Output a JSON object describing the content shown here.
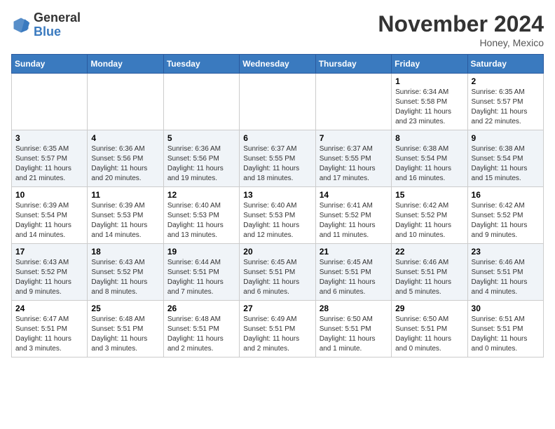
{
  "header": {
    "logo_general": "General",
    "logo_blue": "Blue",
    "month_title": "November 2024",
    "location": "Honey, Mexico"
  },
  "days_of_week": [
    "Sunday",
    "Monday",
    "Tuesday",
    "Wednesday",
    "Thursday",
    "Friday",
    "Saturday"
  ],
  "weeks": [
    [
      {
        "day": "",
        "info": ""
      },
      {
        "day": "",
        "info": ""
      },
      {
        "day": "",
        "info": ""
      },
      {
        "day": "",
        "info": ""
      },
      {
        "day": "",
        "info": ""
      },
      {
        "day": "1",
        "info": "Sunrise: 6:34 AM\nSunset: 5:58 PM\nDaylight: 11 hours and 23 minutes."
      },
      {
        "day": "2",
        "info": "Sunrise: 6:35 AM\nSunset: 5:57 PM\nDaylight: 11 hours and 22 minutes."
      }
    ],
    [
      {
        "day": "3",
        "info": "Sunrise: 6:35 AM\nSunset: 5:57 PM\nDaylight: 11 hours and 21 minutes."
      },
      {
        "day": "4",
        "info": "Sunrise: 6:36 AM\nSunset: 5:56 PM\nDaylight: 11 hours and 20 minutes."
      },
      {
        "day": "5",
        "info": "Sunrise: 6:36 AM\nSunset: 5:56 PM\nDaylight: 11 hours and 19 minutes."
      },
      {
        "day": "6",
        "info": "Sunrise: 6:37 AM\nSunset: 5:55 PM\nDaylight: 11 hours and 18 minutes."
      },
      {
        "day": "7",
        "info": "Sunrise: 6:37 AM\nSunset: 5:55 PM\nDaylight: 11 hours and 17 minutes."
      },
      {
        "day": "8",
        "info": "Sunrise: 6:38 AM\nSunset: 5:54 PM\nDaylight: 11 hours and 16 minutes."
      },
      {
        "day": "9",
        "info": "Sunrise: 6:38 AM\nSunset: 5:54 PM\nDaylight: 11 hours and 15 minutes."
      }
    ],
    [
      {
        "day": "10",
        "info": "Sunrise: 6:39 AM\nSunset: 5:54 PM\nDaylight: 11 hours and 14 minutes."
      },
      {
        "day": "11",
        "info": "Sunrise: 6:39 AM\nSunset: 5:53 PM\nDaylight: 11 hours and 14 minutes."
      },
      {
        "day": "12",
        "info": "Sunrise: 6:40 AM\nSunset: 5:53 PM\nDaylight: 11 hours and 13 minutes."
      },
      {
        "day": "13",
        "info": "Sunrise: 6:40 AM\nSunset: 5:53 PM\nDaylight: 11 hours and 12 minutes."
      },
      {
        "day": "14",
        "info": "Sunrise: 6:41 AM\nSunset: 5:52 PM\nDaylight: 11 hours and 11 minutes."
      },
      {
        "day": "15",
        "info": "Sunrise: 6:42 AM\nSunset: 5:52 PM\nDaylight: 11 hours and 10 minutes."
      },
      {
        "day": "16",
        "info": "Sunrise: 6:42 AM\nSunset: 5:52 PM\nDaylight: 11 hours and 9 minutes."
      }
    ],
    [
      {
        "day": "17",
        "info": "Sunrise: 6:43 AM\nSunset: 5:52 PM\nDaylight: 11 hours and 9 minutes."
      },
      {
        "day": "18",
        "info": "Sunrise: 6:43 AM\nSunset: 5:52 PM\nDaylight: 11 hours and 8 minutes."
      },
      {
        "day": "19",
        "info": "Sunrise: 6:44 AM\nSunset: 5:51 PM\nDaylight: 11 hours and 7 minutes."
      },
      {
        "day": "20",
        "info": "Sunrise: 6:45 AM\nSunset: 5:51 PM\nDaylight: 11 hours and 6 minutes."
      },
      {
        "day": "21",
        "info": "Sunrise: 6:45 AM\nSunset: 5:51 PM\nDaylight: 11 hours and 6 minutes."
      },
      {
        "day": "22",
        "info": "Sunrise: 6:46 AM\nSunset: 5:51 PM\nDaylight: 11 hours and 5 minutes."
      },
      {
        "day": "23",
        "info": "Sunrise: 6:46 AM\nSunset: 5:51 PM\nDaylight: 11 hours and 4 minutes."
      }
    ],
    [
      {
        "day": "24",
        "info": "Sunrise: 6:47 AM\nSunset: 5:51 PM\nDaylight: 11 hours and 3 minutes."
      },
      {
        "day": "25",
        "info": "Sunrise: 6:48 AM\nSunset: 5:51 PM\nDaylight: 11 hours and 3 minutes."
      },
      {
        "day": "26",
        "info": "Sunrise: 6:48 AM\nSunset: 5:51 PM\nDaylight: 11 hours and 2 minutes."
      },
      {
        "day": "27",
        "info": "Sunrise: 6:49 AM\nSunset: 5:51 PM\nDaylight: 11 hours and 2 minutes."
      },
      {
        "day": "28",
        "info": "Sunrise: 6:50 AM\nSunset: 5:51 PM\nDaylight: 11 hours and 1 minute."
      },
      {
        "day": "29",
        "info": "Sunrise: 6:50 AM\nSunset: 5:51 PM\nDaylight: 11 hours and 0 minutes."
      },
      {
        "day": "30",
        "info": "Sunrise: 6:51 AM\nSunset: 5:51 PM\nDaylight: 11 hours and 0 minutes."
      }
    ]
  ]
}
